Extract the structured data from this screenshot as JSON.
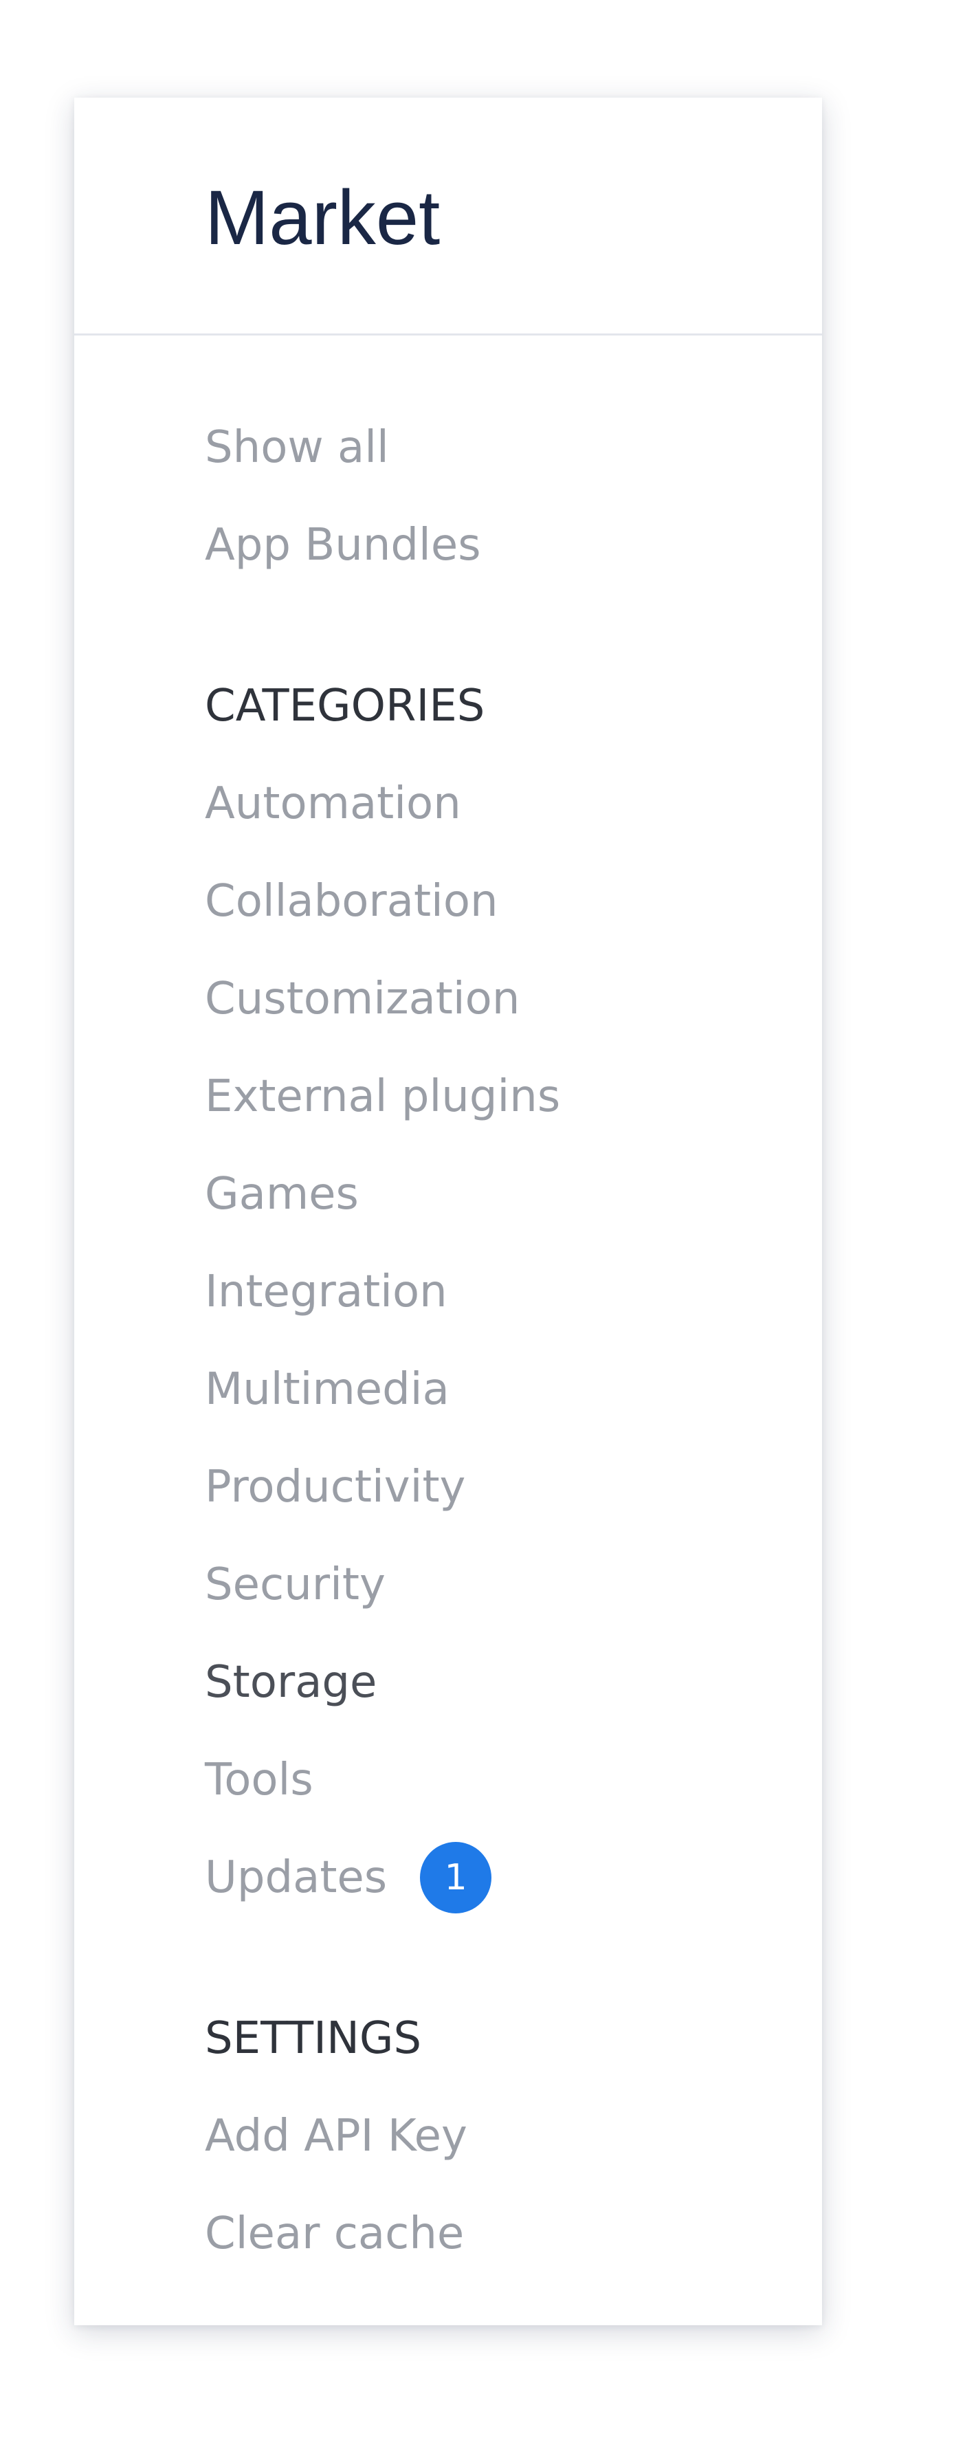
{
  "sidebar": {
    "title": "Market",
    "top_items": [
      {
        "label": "Show all"
      },
      {
        "label": "App Bundles"
      }
    ],
    "categories_heading": "CATEGORIES",
    "categories": [
      {
        "label": "Automation"
      },
      {
        "label": "Collaboration"
      },
      {
        "label": "Customization"
      },
      {
        "label": "External plugins"
      },
      {
        "label": "Games"
      },
      {
        "label": "Integration"
      },
      {
        "label": "Multimedia"
      },
      {
        "label": "Productivity"
      },
      {
        "label": "Security"
      },
      {
        "label": "Storage",
        "active": true
      },
      {
        "label": "Tools"
      },
      {
        "label": "Updates",
        "badge": "1"
      }
    ],
    "settings_heading": "SETTINGS",
    "settings": [
      {
        "label": "Add API Key"
      },
      {
        "label": "Clear cache"
      }
    ]
  },
  "colors": {
    "title": "#1a2745",
    "item": "#9a9ea6",
    "item_active": "#4b4f57",
    "heading": "#2f333b",
    "badge_bg": "#1f7ae8",
    "divider": "#e3e6ec"
  },
  "icons": {
    "badge": "count-badge"
  }
}
